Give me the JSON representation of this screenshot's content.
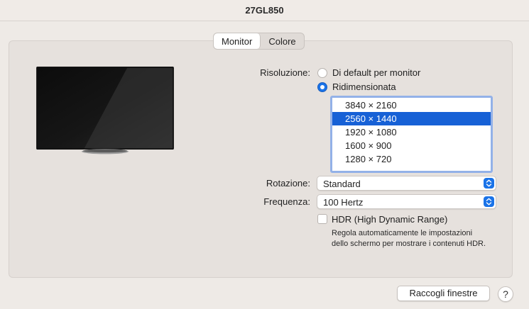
{
  "window": {
    "title": "27GL850"
  },
  "tabs": [
    {
      "label": "Monitor",
      "active": true
    },
    {
      "label": "Colore",
      "active": false
    }
  ],
  "resolution": {
    "label": "Risoluzione:",
    "options": [
      {
        "label": "Di default per monitor",
        "selected": false
      },
      {
        "label": "Ridimensionata",
        "selected": true
      }
    ],
    "list": [
      "3840 × 2160",
      "2560 × 1440",
      "1920 × 1080",
      "1600 × 900",
      "1280 × 720"
    ],
    "selected_index": 1
  },
  "rotation": {
    "label": "Rotazione:",
    "value": "Standard"
  },
  "refresh": {
    "label": "Frequenza:",
    "value": "100 Hertz"
  },
  "hdr": {
    "label": "HDR (High Dynamic Range)",
    "checked": false,
    "note_line1": "Regola automaticamente le impostazioni",
    "note_line2": "dello schermo per mostrare i contenuti HDR."
  },
  "footer": {
    "gather_windows": "Raccogli finestre",
    "help": "?"
  },
  "colors": {
    "accent": "#1a73e8",
    "selection": "#1761d6",
    "focus_ring": "#93b1e8"
  },
  "icons": {
    "stepper": "up-down-chevron-icon",
    "monitor": "display-image"
  }
}
